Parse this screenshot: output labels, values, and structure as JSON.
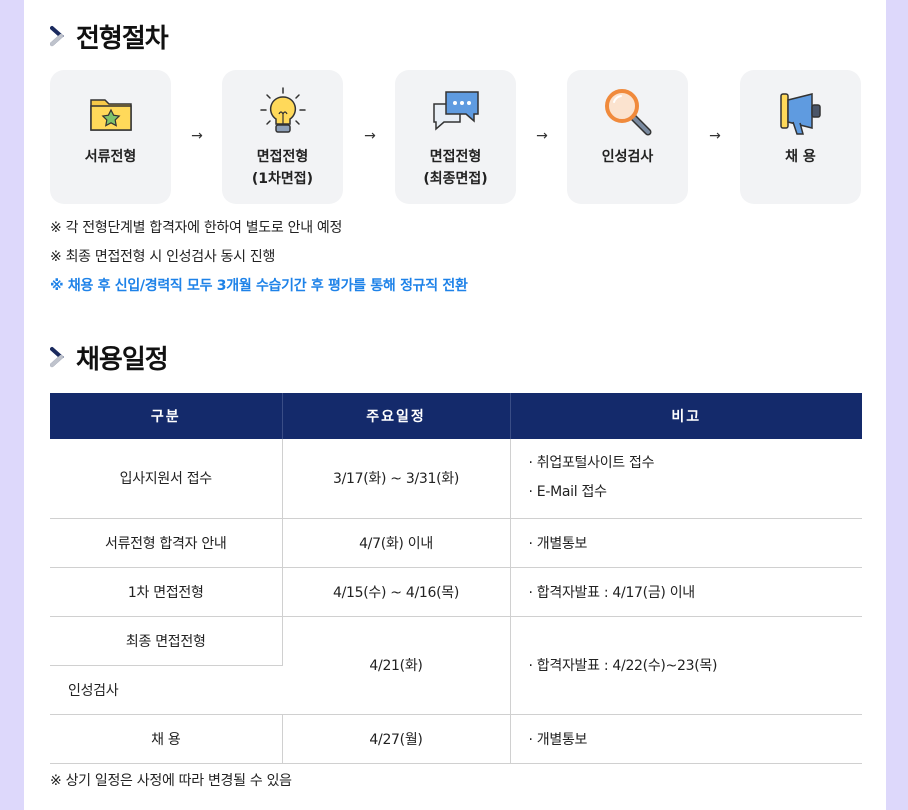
{
  "process": {
    "title": "전형절차",
    "steps": [
      {
        "label": "서류전형",
        "icon": "folder-star-icon"
      },
      {
        "label": "면접전형\n(1차면접)",
        "icon": "lightbulb-icon"
      },
      {
        "label": "면접전형\n(최종면접)",
        "icon": "chat-bubbles-icon"
      },
      {
        "label": "인성검사",
        "icon": "magnifier-icon"
      },
      {
        "label": "채 용",
        "icon": "megaphone-icon"
      }
    ],
    "arrow": "→",
    "notes": [
      "※ 각 전형단계별 합격자에 한하여 별도로 안내 예정",
      "※ 최종 면접전형 시 인성검사 동시 진행",
      "※ 채용 후 신입/경력직 모두 3개월 수습기간 후 평가를 통해 정규직 전환"
    ]
  },
  "schedule": {
    "title": "채용일정",
    "headers": [
      "구분",
      "주요일정",
      "비고"
    ],
    "rows": {
      "r0": {
        "category": "입사지원서 접수",
        "date": "3/17(화) ~ 3/31(화)",
        "note1": "· 취업포털사이트 접수",
        "note2": "· E-Mail 접수"
      },
      "r1": {
        "category": "서류전형 합격자 안내",
        "date": "4/7(화) 이내",
        "note1": "· 개별통보"
      },
      "r2": {
        "category": "1차 면접전형",
        "date": "4/15(수) ~ 4/16(목)",
        "note1": "· 합격자발표 : 4/17(금) 이내"
      },
      "r3": {
        "category": "최종 면접전형",
        "date": "4/21(화)",
        "note1": "· 합격자발표 : 4/22(수)~23(목)"
      },
      "r4": {
        "category": "인성검사"
      },
      "r5": {
        "category": "채 용",
        "date": "4/27(월)",
        "note1": "· 개별통보"
      }
    },
    "footnote": "※ 상기 일정은 사정에 따라 변경될 수 있음"
  },
  "colors": {
    "header_bg": "#142a6b",
    "accent_blue": "#1e82e8",
    "frame": "#ddd8fb"
  }
}
